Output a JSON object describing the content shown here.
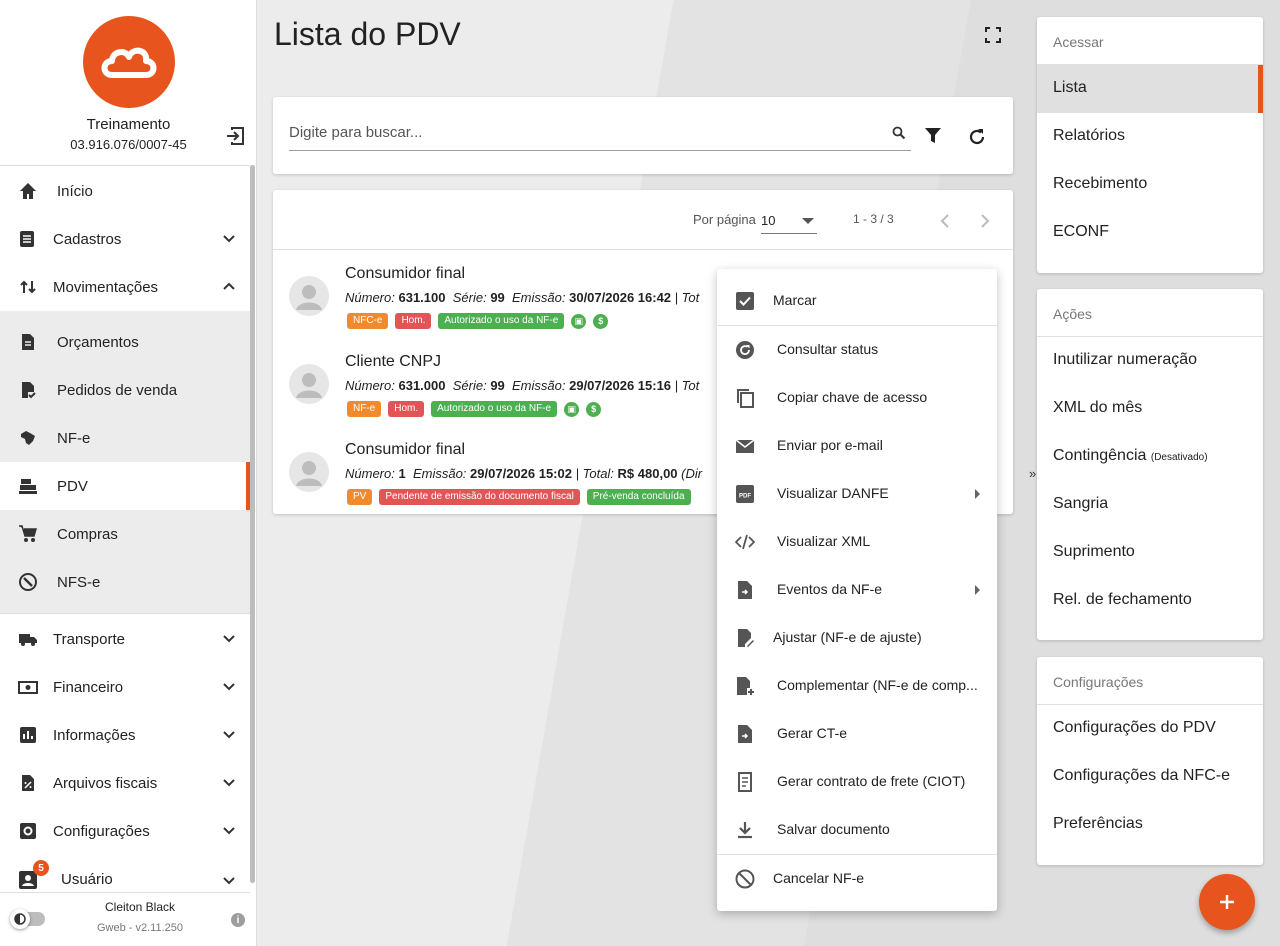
{
  "company": {
    "name": "Treinamento",
    "cnpj": "03.916.076/0007-45"
  },
  "nav": {
    "inicio": "Início",
    "cadastros": "Cadastros",
    "movimentacoes": "Movimentações",
    "sub": [
      "Orçamentos",
      "Pedidos de venda",
      "NF-e",
      "PDV",
      "Compras",
      "NFS-e"
    ],
    "transporte": "Transporte",
    "financeiro": "Financeiro",
    "informacoes": "Informações",
    "arquivos": "Arquivos fiscais",
    "configuracoes": "Configurações",
    "usuario": "Usuário",
    "usuario_badge": "5"
  },
  "footer": {
    "user": "Cleiton Black",
    "version": "Gweb - v2.11.250"
  },
  "page": {
    "title": "Lista do PDV"
  },
  "search": {
    "placeholder": "Digite para buscar..."
  },
  "pager": {
    "label": "Por página",
    "per_page": "10",
    "range": "1 - 3 / 3"
  },
  "rows": [
    {
      "name": "Consumidor final",
      "meta": {
        "numero_label": "Número:",
        "numero": "631.100",
        "serie_label": "Série:",
        "serie": "99",
        "emissao_label": "Emissão:",
        "emissao": "30/07/2026 16:42",
        "tail": "| Tot"
      },
      "tags": [
        "NFC-e",
        "Hom.",
        "Autorizado o uso da NF-e"
      ]
    },
    {
      "name": "Cliente CNPJ",
      "meta": {
        "numero_label": "Número:",
        "numero": "631.000",
        "serie_label": "Série:",
        "serie": "99",
        "emissao_label": "Emissão:",
        "emissao": "29/07/2026 15:16",
        "tail": "| Tot"
      },
      "tags": [
        "NF-e",
        "Hom.",
        "Autorizado o uso da NF-e"
      ]
    },
    {
      "name": "Consumidor final",
      "meta": {
        "numero_label": "Número:",
        "numero": "1",
        "emissao_label": "Emissão:",
        "emissao": "29/07/2026 15:02",
        "total_label": "| Total:",
        "total": "R$ 480,00",
        "tail": "(Dir"
      },
      "tags": [
        "PV",
        "Pendente de emissão do documento fiscal",
        "Pré-venda concluída"
      ]
    }
  ],
  "menu": {
    "marcar": "Marcar",
    "items": [
      "Consultar status",
      "Copiar chave de acesso",
      "Enviar por e-mail",
      "Visualizar DANFE",
      "Visualizar XML",
      "Eventos da NF-e",
      "Ajustar (NF-e de ajuste)",
      "Complementar (NF-e de comp...",
      "Gerar CT-e",
      "Gerar contrato de frete (CIOT)",
      "Salvar documento"
    ],
    "cancelar": "Cancelar NF-e"
  },
  "right": {
    "acessar_head": "Acessar",
    "acessar": [
      "Lista",
      "Relatórios",
      "Recebimento",
      "ECONF"
    ],
    "acoes_head": "Ações",
    "acoes": [
      "Inutilizar numeração",
      "XML do mês",
      "Contingência",
      "Sangria",
      "Suprimento",
      "Rel. de fechamento"
    ],
    "contingencia_note": "(Desativado)",
    "config_head": "Configurações",
    "config": [
      "Configurações do PDV",
      "Configurações da NFC-e",
      "Preferências"
    ]
  },
  "colors": {
    "accent": "#e8541e",
    "green": "#4caf50",
    "red": "#e05656",
    "orange": "#f18a2c"
  }
}
